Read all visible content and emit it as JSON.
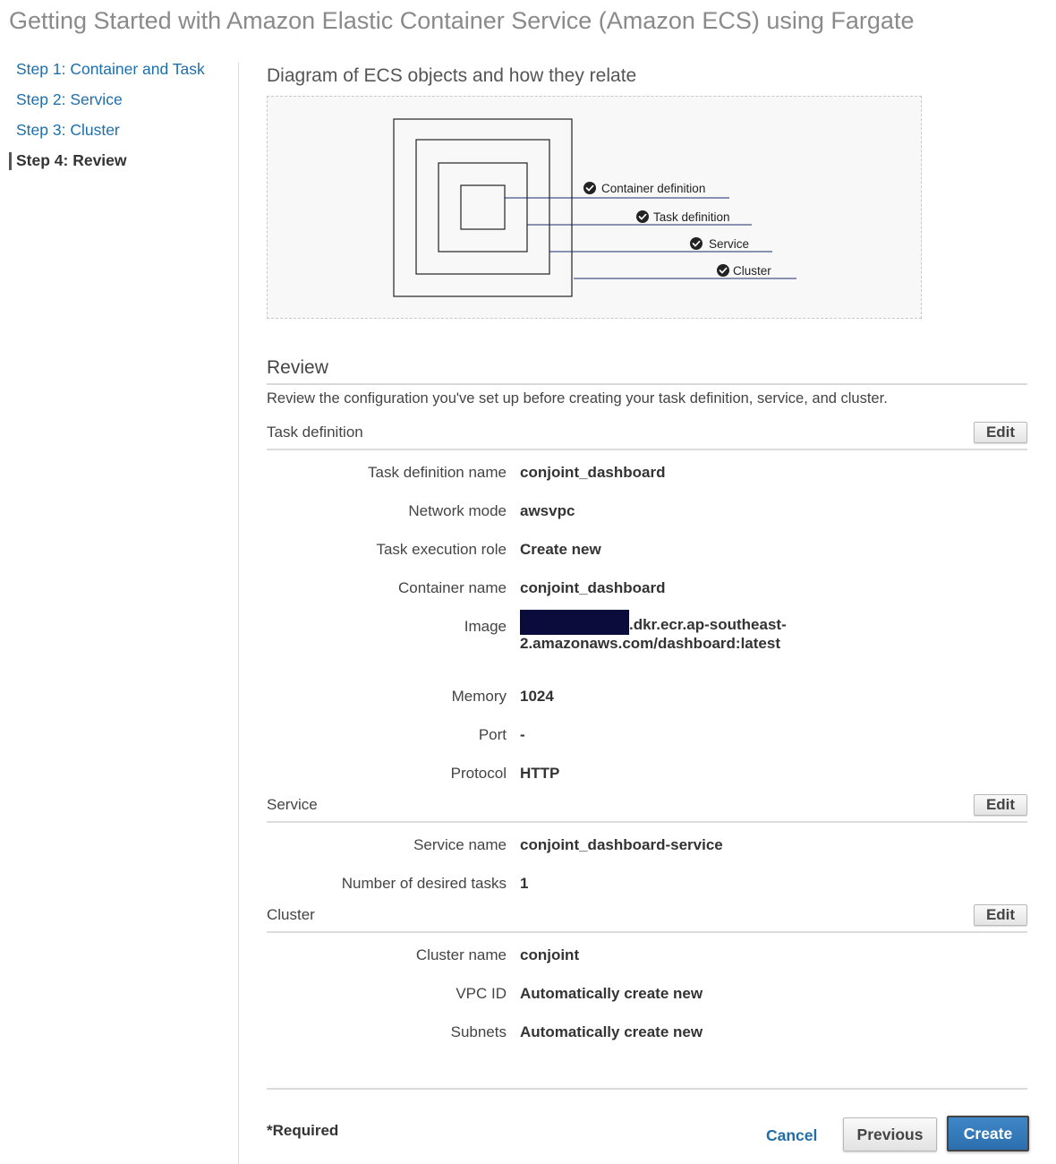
{
  "page_title": "Getting Started with Amazon Elastic Container Service (Amazon ECS) using Fargate",
  "steps": [
    {
      "label": "Step 1: Container and Task",
      "active": false
    },
    {
      "label": "Step 2: Service",
      "active": false
    },
    {
      "label": "Step 3: Cluster",
      "active": false
    },
    {
      "label": "Step 4: Review",
      "active": true
    }
  ],
  "diagram": {
    "title": "Diagram of ECS objects and how they relate",
    "labels": [
      "Container definition",
      "Task definition",
      "Service",
      "Cluster"
    ],
    "icon": "check-circle-icon"
  },
  "review": {
    "title": "Review",
    "description": "Review the configuration you've set up before creating your task definition, service, and cluster.",
    "edit_label": "Edit",
    "task_definition": {
      "title": "Task definition",
      "rows": [
        {
          "key": "Task definition name",
          "value": "conjoint_dashboard"
        },
        {
          "key": "Network mode",
          "value": "awsvpc"
        },
        {
          "key": "Task execution role",
          "value": "Create new"
        },
        {
          "key": "Container name",
          "value": "conjoint_dashboard"
        },
        {
          "key": "Image",
          "value": ".dkr.ecr.ap-southeast-2.amazonaws.com/dashboard:latest"
        },
        {
          "key": "Memory",
          "value": "1024"
        },
        {
          "key": "Port",
          "value": "-"
        },
        {
          "key": "Protocol",
          "value": "HTTP"
        }
      ]
    },
    "service": {
      "title": "Service",
      "rows": [
        {
          "key": "Service name",
          "value": "conjoint_dashboard-service"
        },
        {
          "key": "Number of desired tasks",
          "value": "1"
        }
      ]
    },
    "cluster": {
      "title": "Cluster",
      "rows": [
        {
          "key": "Cluster name",
          "value": "conjoint"
        },
        {
          "key": "VPC ID",
          "value": "Automatically create new"
        },
        {
          "key": "Subnets",
          "value": "Automatically create new"
        }
      ]
    }
  },
  "footer": {
    "required": "*Required",
    "cancel": "Cancel",
    "previous": "Previous",
    "create": "Create"
  },
  "colors": {
    "link": "#1f6ea8",
    "primary_button": "#3479ba",
    "redaction": "#0b0b3c"
  }
}
